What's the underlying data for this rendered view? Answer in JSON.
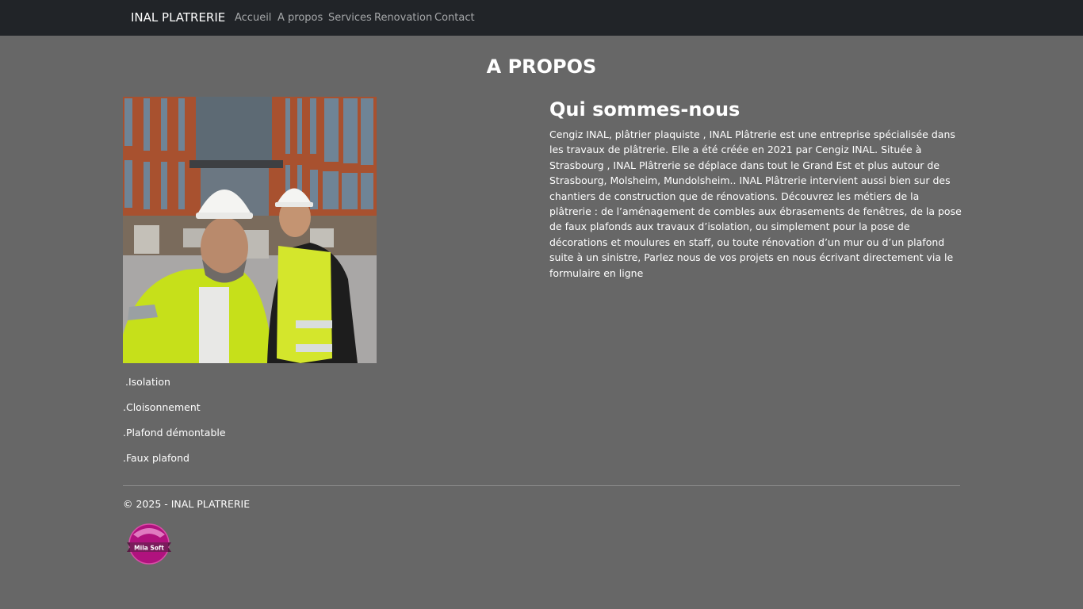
{
  "navbar": {
    "brand": "INAL PLATRERIE",
    "links": [
      {
        "label": "Accueil"
      },
      {
        "label": "A propos"
      },
      {
        "label": "Services"
      },
      {
        "label": "Renovation"
      },
      {
        "label": "Contact"
      }
    ]
  },
  "main": {
    "title": "A PROPOS",
    "photo": {
      "icon": "team-photo"
    },
    "services": [
      ".Isolation",
      ".Cloisonnement",
      ".Plafond démontable",
      ".Faux plafond"
    ],
    "about": {
      "heading": "Qui sommes-nous",
      "text": "Cengiz INAL, plâtrier plaquiste , INAL Plâtrerie est une entreprise spécialisée dans les travaux de plâtrerie. Elle a été créée en 2021 par Cengiz INAL. Située à Strasbourg , INAL Plâtrerie se déplace dans tout le Grand Est et plus autour de Strasbourg, Molsheim, Mundolsheim.. INAL Plâtrerie intervient aussi bien sur des chantiers de construction que de rénovations. Découvrez les métiers de la plâtrerie : de l’aménagement de combles aux ébrasements de fenêtres, de la pose de faux plafonds aux travaux d’isolation, ou simplement pour la pose de décorations et moulures en staff, ou toute rénovation d’un mur ou d’un plafond suite à un sinistre, Parlez nous de vos projets en nous écrivant directement via le formulaire en ligne"
    }
  },
  "footer": {
    "copyright": "© 2025 - INAL PLATRERIE",
    "logo_text": "Mila Soft"
  },
  "colors": {
    "page_background": "#676767",
    "navbar_background": "#212428",
    "nav_link": "#a5a7a9",
    "logo_magenta": "#b0127e"
  }
}
